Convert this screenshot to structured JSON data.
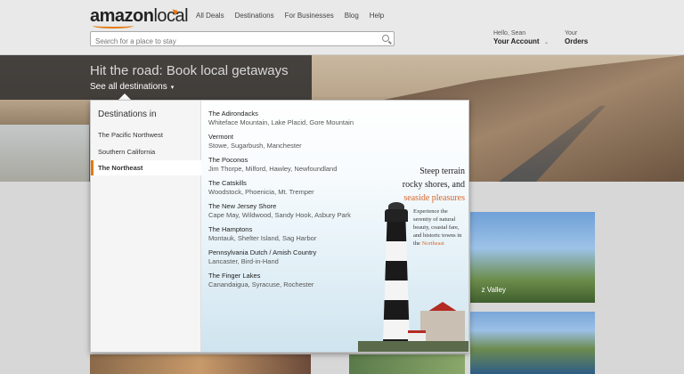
{
  "header": {
    "logo_bold": "amazon",
    "logo_light": "local",
    "nav": [
      "All Deals",
      "Destinations",
      "For Businesses",
      "Blog",
      "Help"
    ],
    "search_placeholder": "Search for a place to stay",
    "greeting": "Hello, Sean",
    "account_label": "Your Account",
    "orders_top": "Your",
    "orders_label": "Orders"
  },
  "hero": {
    "title": "Hit the road: Book local getaways",
    "link": "See all destinations"
  },
  "panel": {
    "heading": "Destinations in",
    "regions": [
      "The Pacific Northwest",
      "Southern California",
      "The Northeast"
    ],
    "active_region": "The Northeast",
    "destinations": [
      {
        "name": "The Adirondacks",
        "towns": "Whiteface Mountain, Lake Placid, Gore Mountain"
      },
      {
        "name": "Vermont",
        "towns": "Stowe, Sugarbush, Manchester"
      },
      {
        "name": "The Poconos",
        "towns": "Jim Thorpe, Milford, Hawley, Newfoundland"
      },
      {
        "name": "The Catskills",
        "towns": "Woodstock, Phoenicia, Mt. Tremper"
      },
      {
        "name": "The New Jersey Shore",
        "towns": "Cape May, Wildwood, Sandy Hook, Asbury Park"
      },
      {
        "name": "The Hamptons",
        "towns": "Montauk, Shelter Island, Sag Harbor"
      },
      {
        "name": "Pennsylvania Dutch / Amish Country",
        "towns": "Lancaster, Bird-in-Hand"
      },
      {
        "name": "The Finger Lakes",
        "towns": "Canandaigua, Syracuse, Rochester"
      }
    ],
    "promo_line1": "Steep terrain",
    "promo_line2": "rocky shores, and",
    "promo_line3": "seaside pleasures",
    "promo_body1": "Experience the serenity of natural beauty, coastal fare, and historic towns in the",
    "promo_body_accent": "Northeast"
  },
  "tiles": {
    "right1_caption": "z Valley"
  },
  "colors": {
    "accent": "#e47911",
    "promo_accent": "#d8662a"
  }
}
